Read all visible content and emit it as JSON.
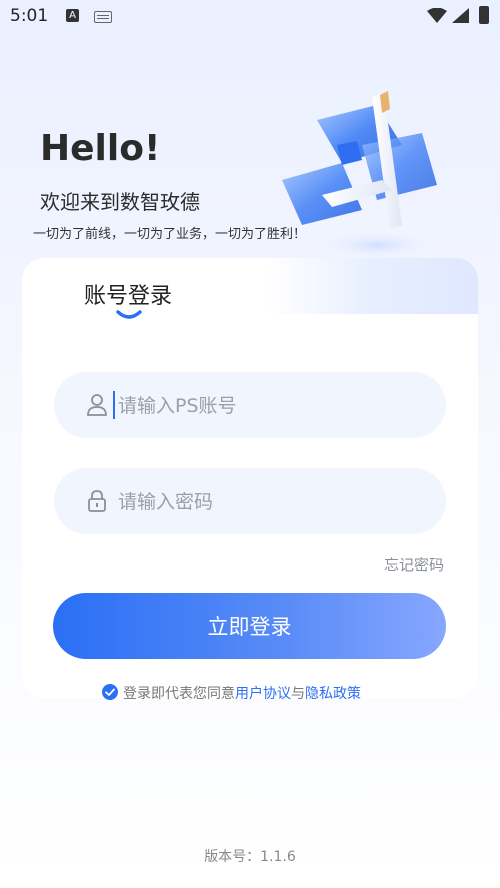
{
  "status_bar": {
    "time": "5:01",
    "app_icon_letter": "A"
  },
  "hero": {
    "greeting": "Hello!",
    "welcome": "欢迎来到数智玫德",
    "slogan": "一切为了前线，一切为了业务，一切为了胜利！"
  },
  "login_card": {
    "tab_label": "账号登录",
    "username_placeholder": "请输入PS账号",
    "password_placeholder": "请输入密码",
    "forgot_password": "忘记密码",
    "login_button": "立即登录",
    "agreement_prefix": "登录即代表您同意",
    "user_agreement": "用户协议",
    "and": "与",
    "privacy_policy": "隐私政策",
    "agreement_checked": true
  },
  "footer": {
    "version": "版本号：1.1.6"
  },
  "colors": {
    "accent": "#2a6ff5",
    "input_bg": "#f1f5fd",
    "muted_text": "#8a8f98"
  },
  "icons": [
    "user-icon",
    "lock-icon",
    "check-circle-icon",
    "wifi-icon",
    "cellular-icon",
    "battery-icon",
    "keyboard-icon"
  ]
}
